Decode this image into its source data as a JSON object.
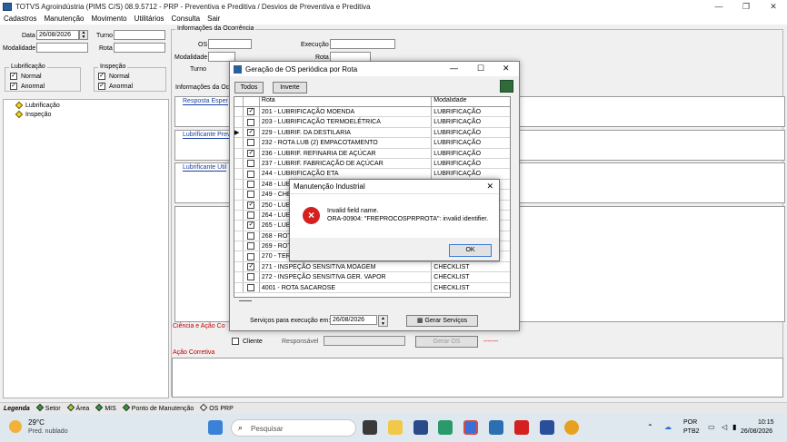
{
  "window": {
    "title": "TOTVS Agroindústria (PIMS C/S) 08.9.5712 - PRP - Preventiva e Preditiva / Desvios de Preventiva e Preditiva",
    "minimize": "—",
    "maximize": "❐",
    "close": "✕"
  },
  "menu": [
    "Cadastros",
    "Manutenção",
    "Movimento",
    "Utilitários",
    "Consulta",
    "Sair"
  ],
  "form": {
    "data_label": "Data",
    "data_value": "26/08/2026",
    "turno_label": "Turno",
    "modalidade_label": "Modalidade",
    "rota_label": "Rota",
    "lubrificacao_group": "Lubrificação",
    "inspecao_group": "Inspeção",
    "normal_label": "Normal",
    "anormal_label": "Anormal",
    "ocorrencia_group": "Informações da Ocorrência",
    "os_label": "OS",
    "execucao_label": "Execução",
    "modalidade2_label": "Modalidade",
    "rota2_label": "Rota",
    "turno2_label": "Turno",
    "info_label": "Informações da Oc",
    "resposta_label": "Resposta Esper",
    "lub_prev_label": "Lubrificante Prev",
    "lub_util_label": "Lubrificante Util",
    "ciencia_label": "Ciência e Ação Co",
    "acao_corretiva_label": "Ação Corretiva",
    "cliente_label": "Cliente",
    "responsavel_label": "Responsável",
    "gerar_os_label": "Gerar OS",
    "dashes": "-------"
  },
  "tree": [
    {
      "label": "Lubrificação"
    },
    {
      "label": "Inspeção"
    }
  ],
  "legend": {
    "title": "Legenda",
    "items": [
      {
        "label": "Setor",
        "color": "#2d9a3a"
      },
      {
        "label": "Área",
        "color": "#9ad03a"
      },
      {
        "label": "MIS",
        "color": "#2d9a3a"
      },
      {
        "label": "Ponto de Manutenção",
        "color": "#2d9a3a"
      },
      {
        "label": "OS PRP",
        "color": "#f0f0f0"
      }
    ]
  },
  "geracao": {
    "title": "Geração de OS periódica por Rota",
    "todos": "Todos",
    "inverte": "Inverte",
    "col_rota": "Rota",
    "col_modalidade": "Modalidade",
    "rows": [
      {
        "checked": true,
        "rota": "201 - LUBRIFICAÇÃO MOENDA",
        "mod": "LUBRIFICAÇÃO"
      },
      {
        "checked": false,
        "rota": "203 - LUBRIFICAÇÃO TERMOELÉTRICA",
        "mod": "LUBRIFICAÇÃO"
      },
      {
        "checked": true,
        "rota": "229 - LUBRIF. DA DESTILARIA",
        "mod": "LUBRIFICAÇÃO"
      },
      {
        "checked": false,
        "rota": "232 - ROTA LUB (2) EMPACOTAMENTO",
        "mod": "LUBRIFICAÇÃO"
      },
      {
        "checked": true,
        "rota": "236 - LUBRIF. REFINARIA DE AÇÚCAR",
        "mod": "LUBRIFICAÇÃO"
      },
      {
        "checked": false,
        "rota": "237 - LUBRIF. FABRICAÇÃO DE AÇÚCAR",
        "mod": "LUBRIFICAÇÃO"
      },
      {
        "checked": false,
        "rota": "244 - LUBRIFICAÇÃO ETA",
        "mod": "LUBRIFICAÇÃO"
      },
      {
        "checked": false,
        "rota": "248 - LUBRI",
        "mod": ""
      },
      {
        "checked": false,
        "rota": "249 - CHEC",
        "mod": ""
      },
      {
        "checked": true,
        "rota": "250 - LUBRI",
        "mod": ""
      },
      {
        "checked": false,
        "rota": "264 - LUBRI",
        "mod": ""
      },
      {
        "checked": true,
        "rota": "265 - LUBRI",
        "mod": ""
      },
      {
        "checked": false,
        "rota": "268 - ROTA",
        "mod": ""
      },
      {
        "checked": false,
        "rota": "269 - ROTA",
        "mod": ""
      },
      {
        "checked": false,
        "rota": "270 - TERM",
        "mod": ""
      },
      {
        "checked": true,
        "rota": "271 - INSPEÇÃO SENSITIVA MOAGEM",
        "mod": "CHECKLIST"
      },
      {
        "checked": false,
        "rota": "272 - INSPEÇÃO SENSITIVA GER. VAPOR",
        "mod": "CHECKLIST"
      },
      {
        "checked": false,
        "rota": "4001 - ROTA SACAROSE",
        "mod": "CHECKLIST"
      }
    ],
    "servicos_label": "Serviços para execução em:",
    "servicos_date": "26/08/2026",
    "gerar_servicos": "Gerar Serviços"
  },
  "error": {
    "title": "Manutenção Industrial",
    "line1": "Invalid field name.",
    "line2": "ORA-00904: \"FREPROCOSPRPROTA\": invalid identifier.",
    "ok": "OK",
    "icon": "×"
  },
  "taskbar": {
    "temp": "29°C",
    "weather": "Pred. nublado",
    "search": "Pesquisar",
    "lang": "POR",
    "layout": "PTB2",
    "time": "10:15",
    "date": "26/08/2026"
  }
}
